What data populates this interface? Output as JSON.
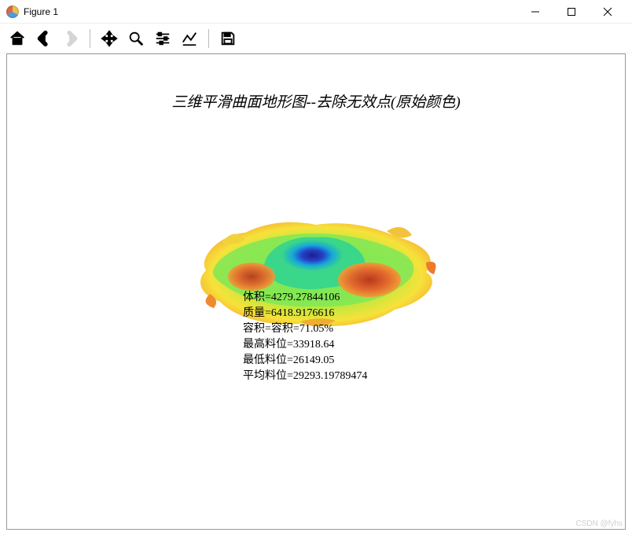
{
  "window": {
    "title": "Figure 1"
  },
  "toolbar": {
    "home": "home-icon",
    "back": "back-icon",
    "forward": "forward-icon",
    "pan": "pan-icon",
    "zoom": "zoom-icon",
    "configure": "configure-icon",
    "edit": "edit-icon",
    "save": "save-icon"
  },
  "chart_data": {
    "type": "surface3d",
    "title": "三维平滑曲面地形图--去除无效点(原始颜色)",
    "colormap": "jet",
    "metrics": {
      "volume_label": "体积",
      "volume": "4279.27844106",
      "mass_label": "质量",
      "mass": "6418.9176616",
      "capacity_label": "容积",
      "capacity_prefix": "容积=",
      "capacity": "71.05%",
      "max_level_label": "最高料位",
      "max_level": "33918.64",
      "min_level_label": "最低料位",
      "min_level": "26149.05",
      "avg_level_label": "平均料位",
      "avg_level": "29293.19789474"
    }
  },
  "watermark": "CSDN @fyhs"
}
